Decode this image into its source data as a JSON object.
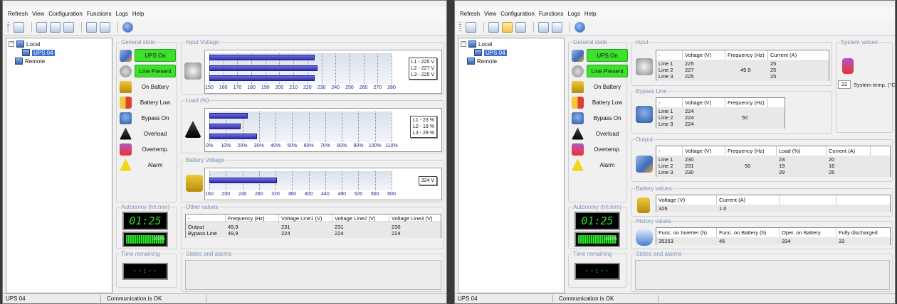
{
  "menu": [
    "Refresh",
    "View",
    "Configuration",
    "Functions",
    "Logs",
    "Help"
  ],
  "tree": {
    "local": "Local",
    "ups": "UPS 04",
    "remote": "Remote"
  },
  "status_bar": {
    "device": "UPS 04",
    "message": "Communication is OK"
  },
  "general_state": {
    "title": "General state",
    "items": [
      {
        "label": "UPS On",
        "on": true,
        "icon": "ups-icon"
      },
      {
        "label": "Line Present",
        "on": true,
        "icon": "plug-icon"
      },
      {
        "label": "On Battery",
        "on": false,
        "icon": "battery-icon"
      },
      {
        "label": "Battery Low",
        "on": false,
        "icon": "battery-low-icon"
      },
      {
        "label": "Bypass On",
        "on": false,
        "icon": "bypass-icon"
      },
      {
        "label": "Overload",
        "on": false,
        "icon": "overload-icon"
      },
      {
        "label": "Overtemp.",
        "on": false,
        "icon": "thermometer-icon"
      },
      {
        "label": "Alarm",
        "on": false,
        "icon": "alarm-icon"
      }
    ]
  },
  "autonomy": {
    "title": "Autonomy (hh:mm)",
    "value": "01:25",
    "battery_percent_label": "100%",
    "battery_level": 1.0
  },
  "time_remaining": {
    "title": "Time remaining",
    "value": "--:--"
  },
  "input_voltage": {
    "title": "Input Voltage",
    "legend": [
      "L1 - 225 V",
      "L2 - 227 V",
      "L3 - 225 V"
    ],
    "chart_data": {
      "type": "bar",
      "orientation": "horizontal",
      "categories": [
        "L1",
        "L2",
        "L3"
      ],
      "values": [
        225,
        227,
        225
      ],
      "xlim": [
        150,
        280
      ],
      "ticks": [
        "150",
        "160",
        "170",
        "180",
        "190",
        "200",
        "210",
        "220",
        "230",
        "240",
        "250",
        "260",
        "270",
        "280"
      ]
    }
  },
  "load": {
    "title": "Load (%)",
    "legend": [
      "L1 - 23 %",
      "L2 - 19 %",
      "L3 - 29 %"
    ],
    "chart_data": {
      "type": "bar",
      "orientation": "horizontal",
      "categories": [
        "L1",
        "L2",
        "L3"
      ],
      "values": [
        23,
        19,
        29
      ],
      "xlim": [
        0,
        110
      ],
      "ticks": [
        "0%",
        "10%",
        "20%",
        "30%",
        "40%",
        "50%",
        "60%",
        "70%",
        "80%",
        "90%",
        "100%",
        "110%"
      ]
    }
  },
  "battery_voltage": {
    "title": "Battery Voltage",
    "legend": [
      "324 V"
    ],
    "chart_data": {
      "type": "bar",
      "orientation": "horizontal",
      "categories": [
        "Battery"
      ],
      "values": [
        324
      ],
      "xlim": [
        160,
        600
      ],
      "ticks": [
        "160",
        "200",
        "240",
        "280",
        "320",
        "360",
        "400",
        "440",
        "480",
        "520",
        "560",
        "600"
      ]
    }
  },
  "other_values": {
    "title": "Other values",
    "headers": [
      "-",
      "Frequency (Hz)",
      "Voltage Line1 (V)",
      "Voltage Line2 (V)",
      "Voltage Line3 (V)"
    ],
    "rows": [
      [
        "Output",
        "49,9",
        "231",
        "231",
        "230"
      ],
      [
        "Bypass Line",
        "49,9",
        "224",
        "224",
        "224"
      ]
    ]
  },
  "states_alarms": {
    "title": "States and alarms"
  },
  "input": {
    "title": "Input",
    "headers": [
      "-",
      "Voltage (V)",
      "Frequency (Hz)",
      "Current (A)"
    ],
    "lines": [
      "Line 1",
      "Line 2",
      "Line 3"
    ],
    "voltage": [
      "225",
      "227",
      "225"
    ],
    "frequency": "49,9",
    "current": [
      "25",
      "25",
      "25"
    ]
  },
  "bypass": {
    "title": "Bypass Line",
    "headers": [
      "-",
      "Voltage (V)",
      "Frequency (Hz)"
    ],
    "lines": [
      "Line 1",
      "Line 2",
      "Line 3"
    ],
    "voltage": [
      "224",
      "224",
      "224"
    ],
    "frequency": "50"
  },
  "output": {
    "title": "Output",
    "headers": [
      "-",
      "Voltage (V)",
      "Frequency (Hz)",
      "Load (%)",
      "Current (A)"
    ],
    "lines": [
      "Line 1",
      "Line 2",
      "Line 3"
    ],
    "voltage": [
      "230",
      "231",
      "230"
    ],
    "frequency": "50",
    "load": [
      "23",
      "19",
      "29"
    ],
    "current": [
      "20",
      "16",
      "25"
    ]
  },
  "battery_values": {
    "title": "Battery values",
    "headers": [
      "Voltage (V)",
      "Current (A)"
    ],
    "row": [
      "326",
      "1.0"
    ]
  },
  "history_values": {
    "title": "History values",
    "headers": [
      "Func. on Inverter (h)",
      "Func. on Battery (h)",
      "Oper. on Battery",
      "Fully discharged"
    ],
    "row": [
      "35253",
      "45",
      "334",
      "33"
    ]
  },
  "system_values": {
    "title": "System values",
    "temp_value": "22",
    "temp_label": "System temp. (°C)"
  }
}
